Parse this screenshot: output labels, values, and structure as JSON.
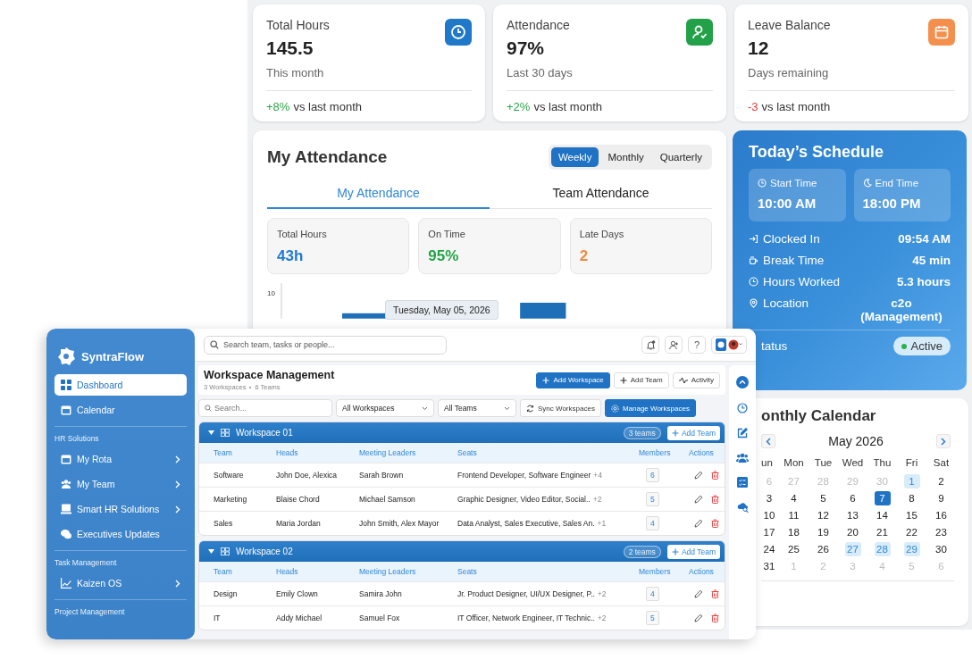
{
  "stat_cards": [
    {
      "title": "Total Hours",
      "value": "145.5",
      "subtitle": "This month",
      "change": {
        "text": "+8%",
        "color": "#2aa548"
      },
      "comparison": "vs last month",
      "color": "#1f78c8"
    },
    {
      "title": "Attendance",
      "value": "97%",
      "subtitle": "Last 30 days",
      "change": {
        "text": "+2%",
        "color": "#2aa548"
      },
      "comparison": "vs last month",
      "color": "#23a148"
    },
    {
      "title": "Leave Balance",
      "value": "12",
      "subtitle": "Days remaining",
      "change": {
        "text": "-3",
        "color": "#e53935"
      },
      "comparison": "vs last month",
      "color": "#f4904e"
    }
  ],
  "attendance": {
    "title": "My Attendance",
    "periods": [
      {
        "label": "Weekly",
        "selected": true
      },
      {
        "label": "Monthly",
        "selected": false
      },
      {
        "label": "Quarterly",
        "selected": false
      }
    ],
    "tabs": [
      {
        "label": "My Attendance",
        "selected": true
      },
      {
        "label": "Team Attendance",
        "selected": false
      }
    ],
    "metrics": [
      {
        "label": "Total Hours",
        "value": "43h",
        "color": "#1f7ad2"
      },
      {
        "label": "On Time",
        "value": "95%",
        "color": "#22a447"
      },
      {
        "label": "Late Days",
        "value": "2",
        "color": "#f08a3c"
      }
    ],
    "chart": {
      "tick": "10",
      "tooltip": "Tuesday, May 05, 2026"
    }
  },
  "schedule": {
    "title": "Today’s Schedule",
    "slots": [
      {
        "label": "Start Time",
        "value": "10:00 AM"
      },
      {
        "label": "End Time",
        "value": "18:00 PM"
      }
    ],
    "details": [
      {
        "label": "Clocked In",
        "value": "09:54 AM"
      },
      {
        "label": "Break Time",
        "value": "45 min"
      },
      {
        "label": "Hours Worked",
        "value": "5.3 hours"
      },
      {
        "label": "Location",
        "value": "c2o (Management)"
      }
    ],
    "status": {
      "label": "tatus",
      "value": "Active",
      "active": true
    }
  },
  "calendar": {
    "title": "onthly Calendar",
    "month": "May 2026",
    "weekdays": [
      "un",
      "Mon",
      "Tue",
      "Wed",
      "Thu",
      "Fri",
      "Sat"
    ],
    "weeks": [
      [
        {
          "day": "6",
          "kind": "outside"
        },
        {
          "day": "27",
          "kind": "outside"
        },
        {
          "day": "28",
          "kind": "outside"
        },
        {
          "day": "29",
          "kind": "outside"
        },
        {
          "day": "30",
          "kind": "outside"
        },
        {
          "day": "1",
          "kind": "event"
        },
        {
          "day": "2",
          "kind": "normal"
        }
      ],
      [
        {
          "day": "3",
          "kind": "normal"
        },
        {
          "day": "4",
          "kind": "normal"
        },
        {
          "day": "5",
          "kind": "normal"
        },
        {
          "day": "6",
          "kind": "normal"
        },
        {
          "day": "7",
          "kind": "today"
        },
        {
          "day": "8",
          "kind": "normal"
        },
        {
          "day": "9",
          "kind": "normal"
        }
      ],
      [
        {
          "day": "10",
          "kind": "normal"
        },
        {
          "day": "11",
          "kind": "normal"
        },
        {
          "day": "12",
          "kind": "normal"
        },
        {
          "day": "13",
          "kind": "normal"
        },
        {
          "day": "14",
          "kind": "normal"
        },
        {
          "day": "15",
          "kind": "normal"
        },
        {
          "day": "16",
          "kind": "normal"
        }
      ],
      [
        {
          "day": "17",
          "kind": "normal"
        },
        {
          "day": "18",
          "kind": "normal"
        },
        {
          "day": "19",
          "kind": "normal"
        },
        {
          "day": "20",
          "kind": "normal"
        },
        {
          "day": "21",
          "kind": "normal"
        },
        {
          "day": "22",
          "kind": "normal"
        },
        {
          "day": "23",
          "kind": "normal"
        }
      ],
      [
        {
          "day": "24",
          "kind": "normal"
        },
        {
          "day": "25",
          "kind": "normal"
        },
        {
          "day": "26",
          "kind": "normal"
        },
        {
          "day": "27",
          "kind": "event"
        },
        {
          "day": "28",
          "kind": "event"
        },
        {
          "day": "29",
          "kind": "event"
        },
        {
          "day": "30",
          "kind": "normal"
        }
      ],
      [
        {
          "day": "31",
          "kind": "normal"
        },
        {
          "day": "1",
          "kind": "outside"
        },
        {
          "day": "2",
          "kind": "outside"
        },
        {
          "day": "3",
          "kind": "outside"
        },
        {
          "day": "4",
          "kind": "outside"
        },
        {
          "day": "5",
          "kind": "outside"
        },
        {
          "day": "6",
          "kind": "outside"
        }
      ]
    ]
  },
  "app": {
    "brand": "SyntraFlow",
    "nav": [
      {
        "kind": "item",
        "label": "Dashboard",
        "selected": true,
        "expandable": false
      },
      {
        "kind": "item",
        "label": "Calendar",
        "selected": false,
        "expandable": false
      },
      {
        "kind": "section",
        "label": "HR Solutions"
      },
      {
        "kind": "item",
        "label": "My Rota",
        "selected": false,
        "expandable": true
      },
      {
        "kind": "item",
        "label": "My Team",
        "selected": false,
        "expandable": true
      },
      {
        "kind": "item",
        "label": "Smart HR Solutions",
        "selected": false,
        "expandable": true
      },
      {
        "kind": "item",
        "label": "Executives Updates",
        "selected": false,
        "expandable": false
      },
      {
        "kind": "section",
        "label": "Task Management"
      },
      {
        "kind": "item",
        "label": "Kaizen OS",
        "selected": false,
        "expandable": true
      },
      {
        "kind": "section",
        "label": "Project Management"
      }
    ],
    "search_placeholder": "Search team, tasks or people...",
    "help_label": "?",
    "page_title": "Workspace Management",
    "meta": [
      "3 Workspaces",
      "6 Teams"
    ],
    "actions": [
      {
        "label": "Add Workspace",
        "primary": true
      },
      {
        "label": "Add Team",
        "primary": false
      },
      {
        "label": "Activity",
        "primary": false
      }
    ],
    "filter_placeholder": "Search...",
    "selects": [
      "All Workspaces",
      "All Teams"
    ],
    "filter_buttons": [
      {
        "label": "Sync Workspaces",
        "primary": false
      },
      {
        "label": "Manage Workspaces",
        "primary": true
      }
    ],
    "workspaces": [
      {
        "name": "Workspace 01",
        "expanded": true,
        "count": "3 teams",
        "add_label": "Add Team",
        "columns": [
          "Team",
          "Heads",
          "Meeting Leaders",
          "Seats",
          "Members",
          "Actions"
        ],
        "rows": [
          {
            "team": "Software",
            "heads": "John Doe, Alexica",
            "leaders": "Sarah Brown",
            "seats": "Frontend Developer, Software Engineer",
            "extra": "+4",
            "members": "6"
          },
          {
            "team": "Marketing",
            "heads": "Blaise Chord",
            "leaders": "Michael Samson",
            "seats": "Graphic Designer, Video Editor, Social..",
            "extra": "+2",
            "members": "5"
          },
          {
            "team": "Sales",
            "heads": "Maria Jordan",
            "leaders": "John Smith, Alex Mayor",
            "seats": "Data Analyst, Sales Executive, Sales An.",
            "extra": "+1",
            "members": "4"
          }
        ]
      },
      {
        "name": "Workspace 02",
        "expanded": true,
        "count": "2 teams",
        "add_label": "Add Team",
        "columns": [
          "Team",
          "Heads",
          "Meeting Leaders",
          "Seats",
          "Members",
          "Actions"
        ],
        "rows": [
          {
            "team": "Design",
            "heads": "Emily Clown",
            "leaders": "Samira John",
            "seats": "Jr. Product Designer, UI/UX Designer, P..",
            "extra": "+2",
            "members": "4"
          },
          {
            "team": "IT",
            "heads": "Addy Michael",
            "leaders": "Samuel Fox",
            "seats": "IT Officer, Network Engineer, IT Technic..",
            "extra": "+2",
            "members": "5"
          }
        ]
      }
    ]
  }
}
